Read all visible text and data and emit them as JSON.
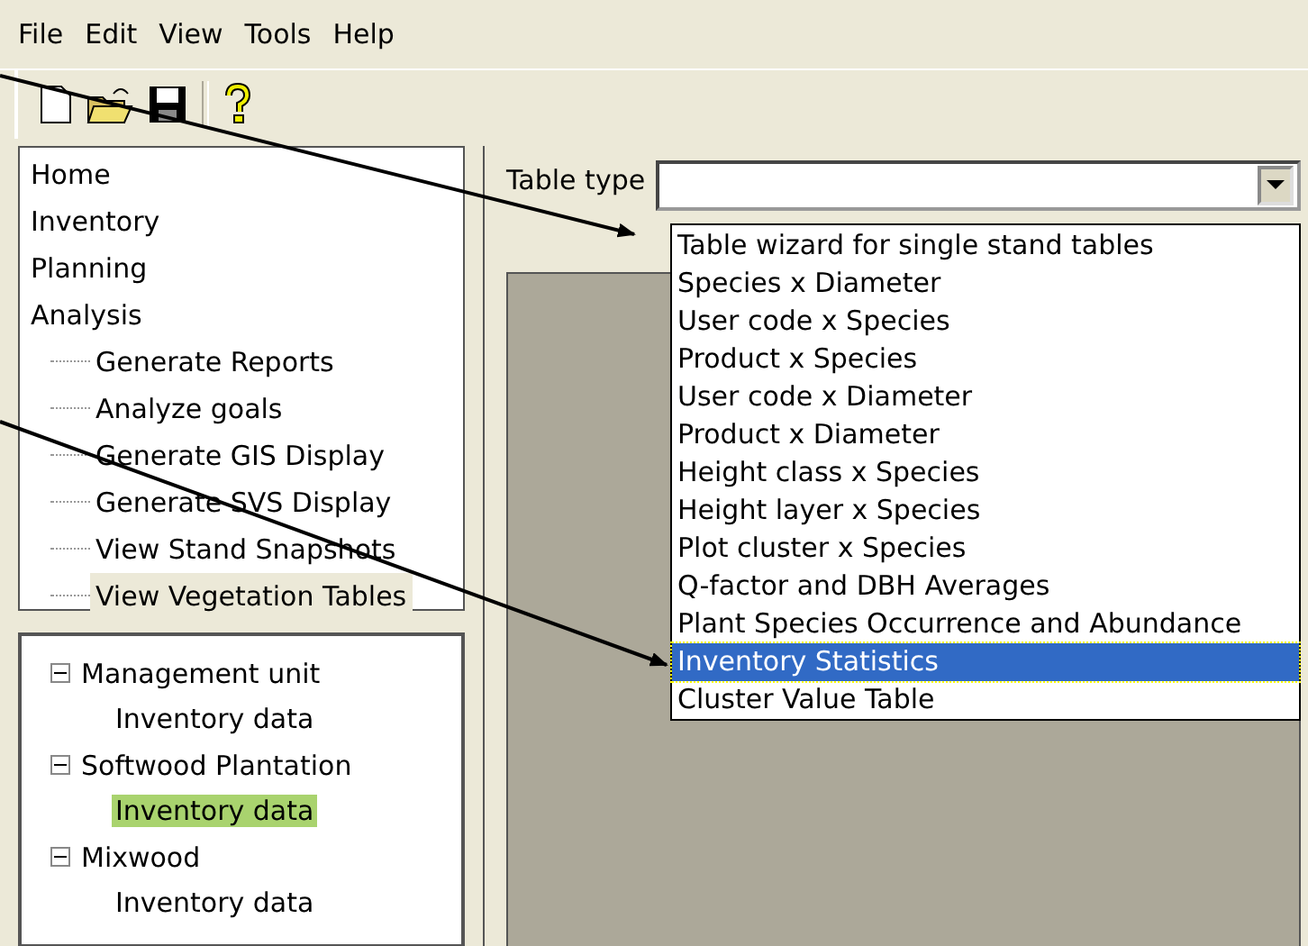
{
  "menu": [
    "File",
    "Edit",
    "View",
    "Tools",
    "Help"
  ],
  "toolbar": [
    {
      "kind": "new"
    },
    {
      "kind": "open"
    },
    {
      "kind": "save"
    },
    {
      "kind": "separator"
    },
    {
      "kind": "help"
    }
  ],
  "navigation": [
    {
      "label": "Home",
      "selected": false
    },
    {
      "label": "Inventory",
      "selected": false
    },
    {
      "label": "Planning",
      "selected": false
    },
    {
      "label": "Analysis",
      "selected": false,
      "children": [
        {
          "label": "Generate Reports",
          "selected": false
        },
        {
          "label": "Analyze goals",
          "selected": false
        },
        {
          "label": "Generate GIS Display",
          "selected": false
        },
        {
          "label": "Generate SVS Display",
          "selected": false
        },
        {
          "label": "View Stand Snapshots",
          "selected": false
        },
        {
          "label": "View Vegetation Tables",
          "selected": true
        }
      ]
    }
  ],
  "tree": [
    {
      "label": "Management unit",
      "expanded": true,
      "selected": false,
      "children": [
        {
          "label": "Inventory data",
          "selected": false
        }
      ]
    },
    {
      "label": "Softwood Plantation",
      "expanded": true,
      "selected": false,
      "children": [
        {
          "label": "Inventory data",
          "selected": true
        }
      ]
    },
    {
      "label": "Mixwood",
      "expanded": true,
      "selected": false,
      "children": [
        {
          "label": "Inventory data",
          "selected": false
        }
      ]
    }
  ],
  "table_type": {
    "label": "Table type",
    "expanded": true,
    "options": [
      {
        "label": "Table wizard for single stand tables",
        "selected": false
      },
      {
        "label": "Species x Diameter",
        "selected": false
      },
      {
        "label": "User code x Species",
        "selected": false
      },
      {
        "label": "Product x Species",
        "selected": false
      },
      {
        "label": "User code x Diameter",
        "selected": false
      },
      {
        "label": "Product x Diameter",
        "selected": false
      },
      {
        "label": "Height class x Species",
        "selected": false
      },
      {
        "label": "Height layer x Species",
        "selected": false
      },
      {
        "label": "Plot cluster x Species",
        "selected": false
      },
      {
        "label": "Q-factor and DBH Averages",
        "selected": false
      },
      {
        "label": "Plant Species Occurrence and Abundance",
        "selected": false
      },
      {
        "label": "Inventory Statistics",
        "selected": true
      },
      {
        "label": "Cluster Value Table",
        "selected": false
      }
    ]
  }
}
